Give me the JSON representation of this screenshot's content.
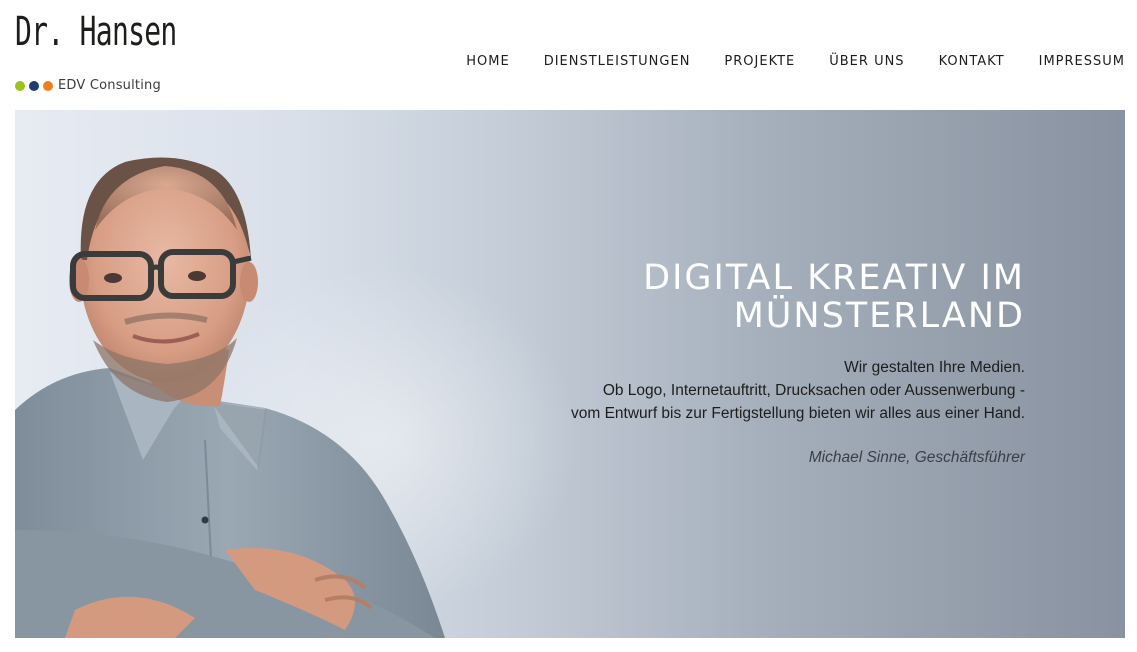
{
  "brand": {
    "name": "Dr. Hansen",
    "tagline": "EDV Consulting",
    "dot_colors": [
      "#9bc21d",
      "#1c3f73",
      "#ee7f1a"
    ]
  },
  "nav": {
    "items": [
      {
        "label": "HOME"
      },
      {
        "label": "DIENSTLEISTUNGEN"
      },
      {
        "label": "PROJEKTE"
      },
      {
        "label": "ÜBER UNS"
      },
      {
        "label": "KONTAKT"
      },
      {
        "label": "IMPRESSUM"
      }
    ]
  },
  "hero": {
    "title_line1": "DIGITAL KREATIV IM",
    "title_line2": "MÜNSTERLAND",
    "line1": "Wir gestalten Ihre Medien.",
    "line2": "Ob Logo, Internetauftritt, Drucksachen oder Aussenwerbung -",
    "line3": "vom Entwurf bis zur Fertigstellung bieten wir alles aus einer Hand.",
    "signature": "Michael Sinne, Geschäftsführer"
  }
}
